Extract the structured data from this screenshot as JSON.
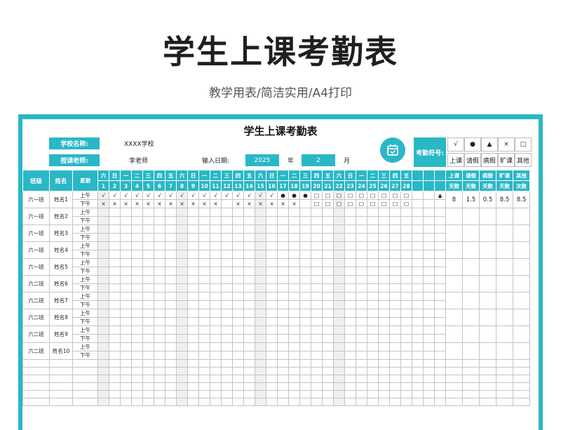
{
  "header": {
    "title": "学生上课考勤表",
    "subtitle": "教学用表/简洁实用/A4打印"
  },
  "sheet": {
    "title": "学生上课考勤表",
    "school_label": "学校名称:",
    "school_value": "XXXX学校",
    "teacher_label": "授课老师:",
    "teacher_value": "李老师",
    "date_label": "输入日期:",
    "year_value": "2025",
    "year_unit": "年",
    "month_value": "2",
    "month_unit": "月",
    "symbol_label": "考勤符号:",
    "symbols": [
      "√",
      "●",
      "▲",
      "×",
      "□"
    ],
    "symbol_names": [
      "上课",
      "请假",
      "病假",
      "旷课",
      "其他"
    ],
    "icon": "calendar-check-icon",
    "accent_color": "#2ab7c6"
  },
  "table": {
    "col_class": "班级",
    "col_name": "姓名",
    "col_week": "星期",
    "weekdays": [
      "六",
      "日",
      "一",
      "二",
      "三",
      "四",
      "五",
      "六",
      "日",
      "一",
      "二",
      "三",
      "四",
      "五",
      "六",
      "日",
      "一",
      "二",
      "三",
      "四",
      "五",
      "六",
      "日",
      "一",
      "二",
      "三",
      "四",
      "五"
    ],
    "days": [
      "1",
      "2",
      "3",
      "4",
      "5",
      "6",
      "7",
      "8",
      "9",
      "10",
      "11",
      "12",
      "13",
      "14",
      "15",
      "16",
      "17",
      "18",
      "19",
      "20",
      "21",
      "22",
      "23",
      "24",
      "25",
      "26",
      "27",
      "28"
    ],
    "summary_headers": [
      "上课",
      "请假",
      "病假",
      "旷课",
      "其他"
    ],
    "summary_sub": [
      "天数",
      "天数",
      "天数",
      "天数",
      "次数"
    ],
    "am_label": "上午",
    "pm_label": "下午",
    "students": [
      {
        "class": "六一班",
        "name": "姓名1",
        "am": [
          "√",
          "√",
          "√",
          "√",
          "√",
          "√",
          "√",
          "√",
          "√",
          "√",
          "√",
          "√",
          "√",
          "√",
          "√",
          "√",
          "●",
          "●",
          "●",
          "□",
          "□",
          "□",
          "□",
          "□",
          "□",
          "□",
          "□",
          "□",
          "",
          "",
          "▲"
        ],
        "pm": [
          "×",
          "×",
          "×",
          "×",
          "×",
          "×",
          "×",
          "×",
          "×",
          "×",
          "×",
          "",
          "×",
          "×",
          "×",
          "×",
          "×",
          "×",
          "",
          "□",
          "□",
          "□",
          "□",
          "□",
          "□",
          "□",
          "□",
          "□",
          "",
          "",
          ""
        ],
        "summary": [
          "8",
          "1.5",
          "0.5",
          "8.5",
          "8.5"
        ]
      },
      {
        "class": "六一班",
        "name": "姓名2",
        "am": [],
        "pm": [],
        "summary": [
          "",
          "",
          "",
          "",
          ""
        ]
      },
      {
        "class": "六一班",
        "name": "姓名3",
        "am": [],
        "pm": [],
        "summary": [
          "",
          "",
          "",
          "",
          ""
        ]
      },
      {
        "class": "六一班",
        "name": "姓名4",
        "am": [],
        "pm": [],
        "summary": [
          "",
          "",
          "",
          "",
          ""
        ]
      },
      {
        "class": "六一班",
        "name": "姓名5",
        "am": [],
        "pm": [],
        "summary": [
          "",
          "",
          "",
          "",
          ""
        ]
      },
      {
        "class": "六二班",
        "name": "姓名6",
        "am": [],
        "pm": [],
        "summary": [
          "",
          "",
          "",
          "",
          ""
        ]
      },
      {
        "class": "六二班",
        "name": "姓名7",
        "am": [],
        "pm": [],
        "summary": [
          "",
          "",
          "",
          "",
          ""
        ]
      },
      {
        "class": "六二班",
        "name": "姓名8",
        "am": [],
        "pm": [],
        "summary": [
          "",
          "",
          "",
          "",
          ""
        ]
      },
      {
        "class": "六二班",
        "name": "姓名9",
        "am": [],
        "pm": [],
        "summary": [
          "",
          "",
          "",
          "",
          ""
        ]
      },
      {
        "class": "六二班",
        "name": "姓名10",
        "am": [],
        "pm": [],
        "summary": [
          "",
          "",
          "",
          "",
          ""
        ]
      }
    ]
  }
}
